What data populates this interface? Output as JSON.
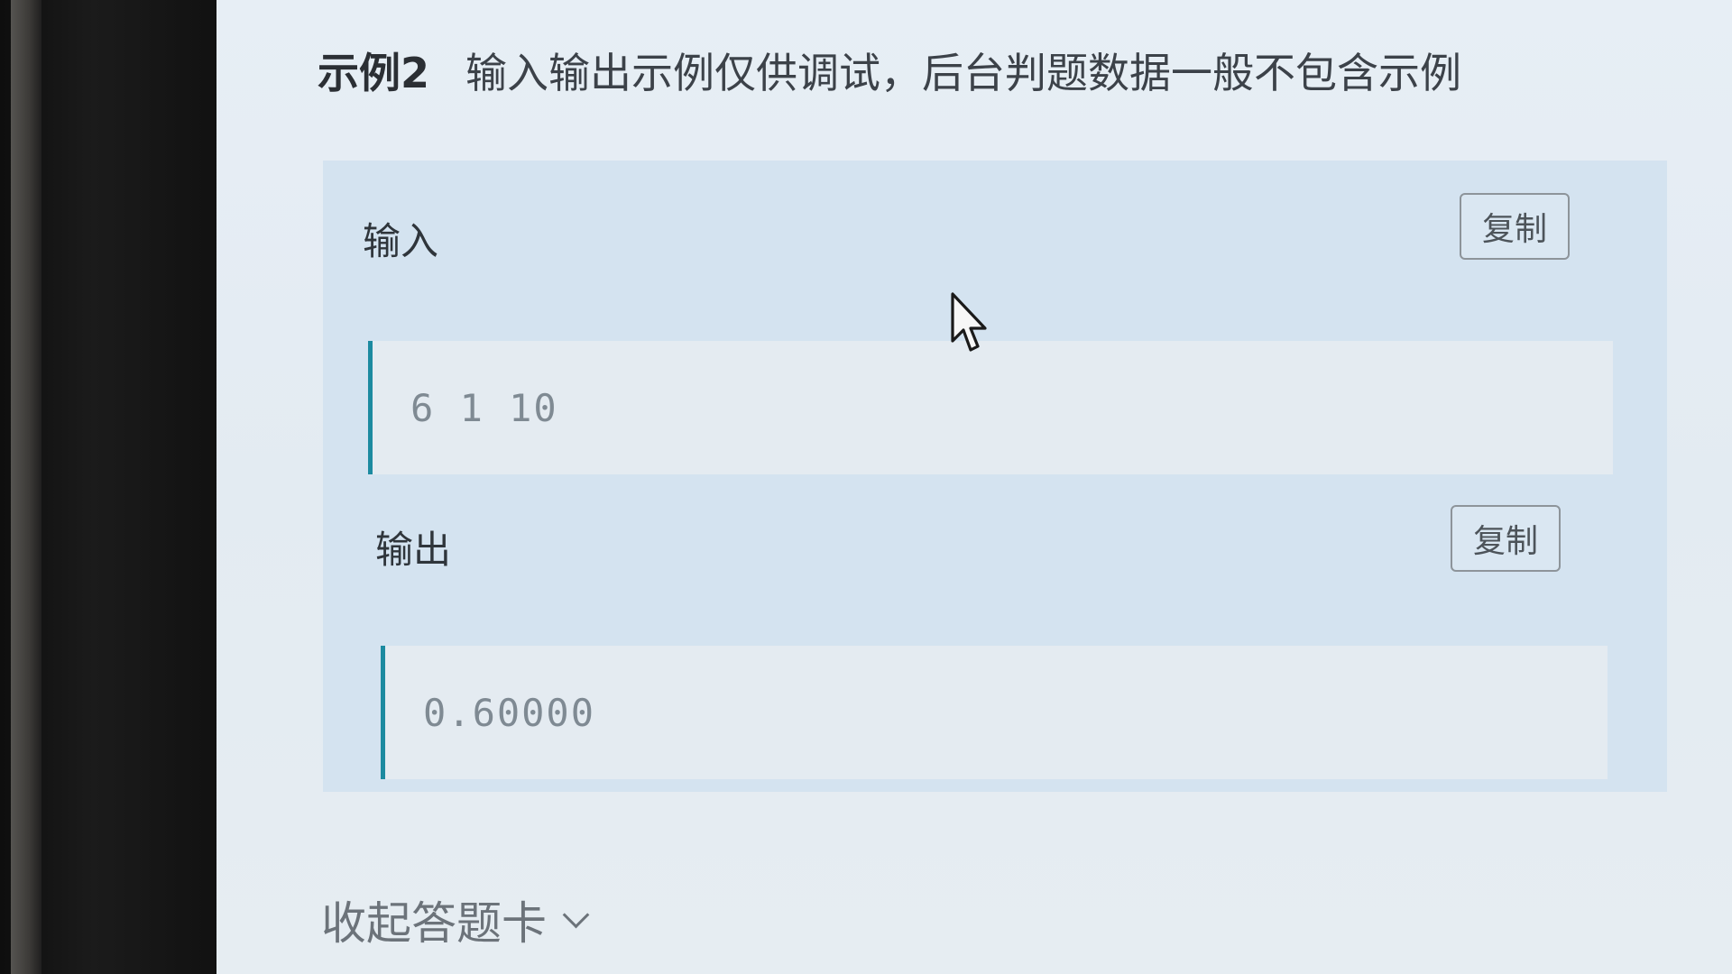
{
  "example": {
    "title": "示例2",
    "note": "输入输出示例仅供调试，后台判题数据一般不包含示例"
  },
  "input": {
    "label": "输入",
    "copy_label": "复制",
    "value": "6 1 10"
  },
  "output": {
    "label": "输出",
    "copy_label": "复制",
    "value": "0.60000"
  },
  "footer": {
    "collapse_label": "收起答题卡",
    "icon": "chevron-down-icon"
  },
  "colors": {
    "accent": "#1c8aa0",
    "panel": "#d4e3f0"
  }
}
